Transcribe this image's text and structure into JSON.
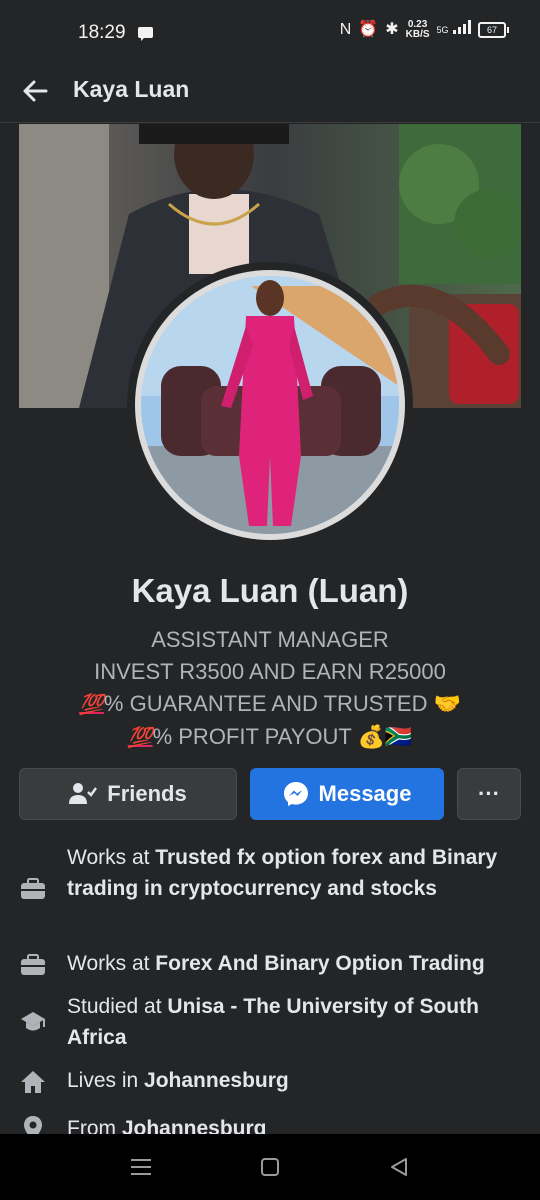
{
  "status_bar": {
    "time": "18:29",
    "speed_value": "0.23",
    "speed_unit": "KB/S",
    "network": "5G",
    "battery": "67"
  },
  "header": {
    "title": "Kaya Luan"
  },
  "profile": {
    "name": "Kaya Luan (Luan)",
    "bio_line1": "ASSISTANT  MANAGER",
    "bio_line2": "INVEST R3500 AND EARN R25000",
    "bio_line3_badge": "💯",
    "bio_line3_text": "% GUARANTEE AND TRUSTED 🤝",
    "bio_line4_badge": "💯",
    "bio_line4_text": "% PROFIT PAYOUT 💰🇿🇦"
  },
  "actions": {
    "friends_label": "Friends",
    "message_label": "Message",
    "more_label": "···"
  },
  "details": [
    {
      "icon": "briefcase-icon",
      "prefix": "Works at ",
      "bold": "Trusted fx option forex and Binary trading in cryptocurrency and stocks"
    },
    {
      "icon": "briefcase-icon",
      "prefix": "Works at ",
      "bold": "Forex And Binary Option Trading"
    },
    {
      "icon": "graduation-cap-icon",
      "prefix": "Studied at ",
      "bold": "Unisa - The University of South Africa"
    },
    {
      "icon": "home-icon",
      "prefix": "Lives in ",
      "bold": "Johannesburg"
    },
    {
      "icon": "location-pin-icon",
      "prefix": "From ",
      "bold": "Johannesburg"
    }
  ],
  "colors": {
    "background": "#242527",
    "accent": "#2374e1",
    "secondary_button": "#3a3b3c"
  }
}
